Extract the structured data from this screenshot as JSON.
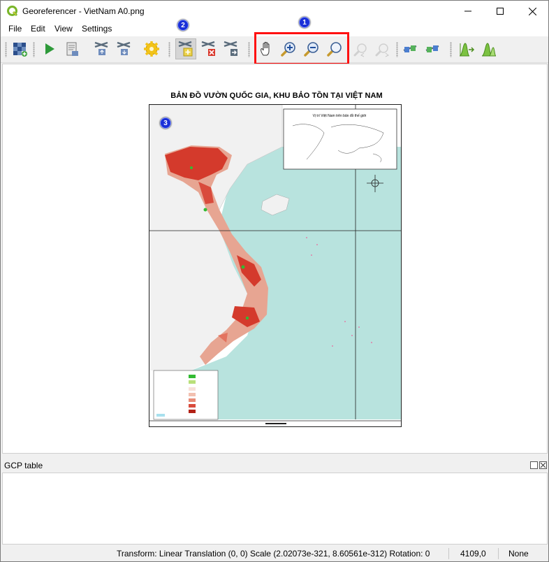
{
  "window": {
    "title": "Georeferencer - VietNam A0.png",
    "controls": [
      "minimize",
      "maximize",
      "close"
    ]
  },
  "menu": {
    "items": [
      "File",
      "Edit",
      "View",
      "Settings"
    ]
  },
  "toolbar": {
    "buttons": [
      "open-raster-icon",
      "start-georeferencing-icon",
      "generate-gdal-script-icon",
      "load-gcp-points-icon",
      "save-gcp-points-icon",
      "transformation-settings-icon",
      "add-point-icon",
      "delete-point-icon",
      "move-gcp-point-icon",
      "pan-icon",
      "zoom-in-icon",
      "zoom-out-icon",
      "zoom-to-layer-icon",
      "zoom-last-icon",
      "zoom-next-icon",
      "link-georeferencer-to-qgis-icon",
      "link-qgis-to-georeferencer-icon",
      "full-histogram-stretch-icon",
      "local-histogram-stretch-icon"
    ],
    "active_button": "add-point-icon"
  },
  "annotations": {
    "badge_1": "1",
    "badge_2": "2",
    "badge_3": "3",
    "highlight_color": "#ff1111",
    "badge_color": "#1a2fd8"
  },
  "map": {
    "title": "BẢN ĐỒ VƯỜN QUỐC GIA, KHU BẢO TỒN TẠI VIỆT NAM",
    "inset_title": "Vị trí Việt Nam trên bản đồ thế giới",
    "colors": {
      "sea": "#b8e3de",
      "land": "#f4f4f4",
      "forest": "#d43a2c",
      "green": "#33bb33"
    }
  },
  "gcp_panel": {
    "title": "GCP table"
  },
  "status": {
    "transform": "Transform: Linear Translation (0, 0) Scale (2.02073e-321, 8.60561e-312) Rotation: 0",
    "coordinates": "4109,0",
    "crs": "None"
  }
}
